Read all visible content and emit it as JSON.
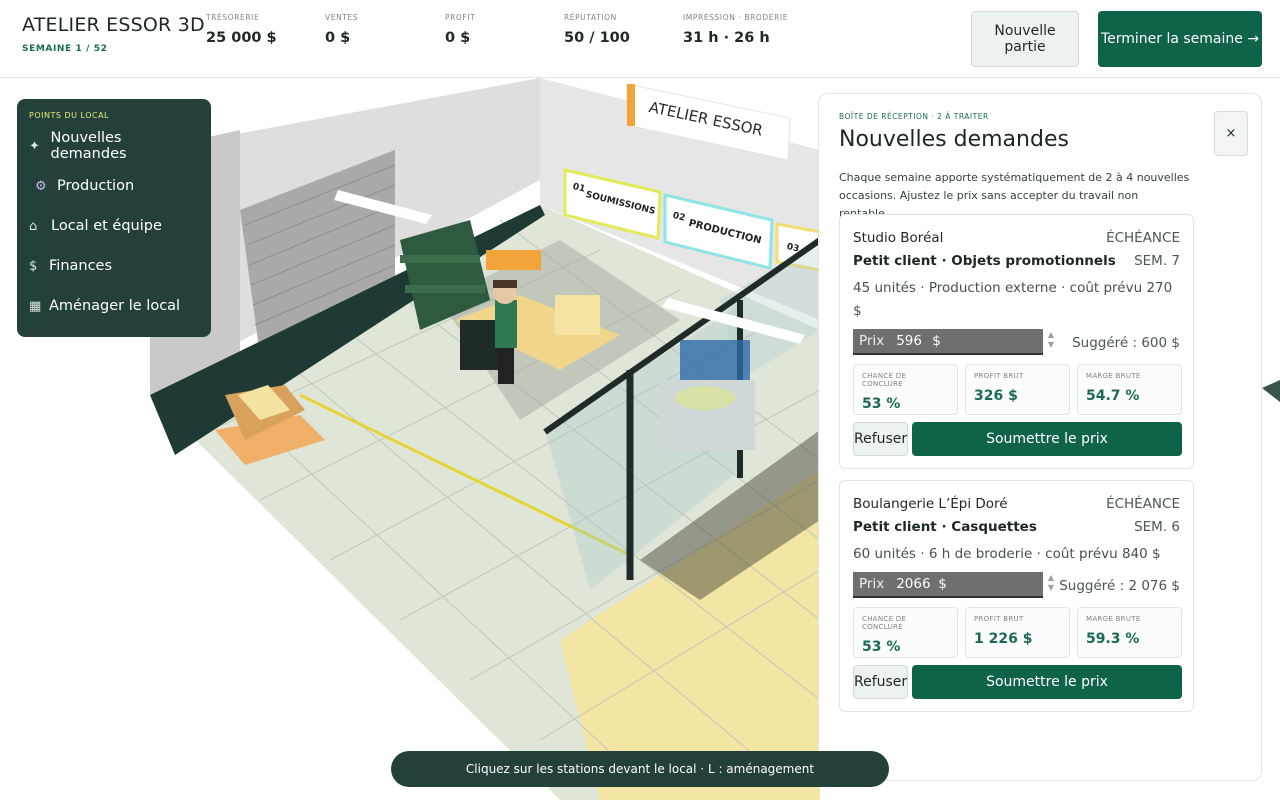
{
  "app": {
    "title": "ATELIER ESSOR 3D",
    "week": "SEMAINE 1 / 52"
  },
  "stats": [
    {
      "label": "TRÉSORERIE",
      "value": "25 000 $"
    },
    {
      "label": "VENTES",
      "value": "0 $"
    },
    {
      "label": "PROFIT",
      "value": "0 $"
    },
    {
      "label": "RÉPUTATION",
      "value": "50 / 100"
    },
    {
      "label": "IMPRESSION · BRODERIE",
      "value": "31 h · 26 h"
    }
  ],
  "actions": {
    "new_game": "Nouvelle partie",
    "end_week": "Terminer la semaine →"
  },
  "nav": {
    "heading": "POINTS DU LOCAL",
    "items": [
      {
        "icon": "sparkle-icon",
        "glyph": "✦",
        "label": "Nouvelles demandes"
      },
      {
        "icon": "gear-icon",
        "glyph": "⚙",
        "label": "Production"
      },
      {
        "icon": "home-icon",
        "glyph": "⌂",
        "label": "Local et équipe"
      },
      {
        "icon": "dollar-icon",
        "glyph": "$",
        "label": "Finances"
      },
      {
        "icon": "grid-icon",
        "glyph": "▦",
        "label": "Aménager le local"
      }
    ]
  },
  "scene": {
    "sign": "ATELIER ESSOR",
    "stations": [
      {
        "num": "01",
        "label": "SOUMISSIONS"
      },
      {
        "num": "02",
        "label": "PRODUCTION"
      },
      {
        "num": "03",
        "label": ""
      }
    ]
  },
  "inbox": {
    "kicker": "BOÎTE DE RÉCEPTION · 2 À TRAITER",
    "title": "Nouvelles demandes",
    "close": "×",
    "description": "Chaque semaine apporte systématiquement de 2 à 4 nouvelles occasions. Ajustez le prix sans accepter du travail non rentable.",
    "due_label": "ÉCHÉANCE",
    "price_label": "Prix",
    "currency": "$",
    "refuse": "Refuser",
    "submit": "Soumettre le prix",
    "metric_labels": [
      "CHANCE DE CONCLURE",
      "PROFIT BRUT",
      "MARGE BRUTE"
    ],
    "requests": [
      {
        "client": "Studio Boréal",
        "type": "Petit client · Objets promotionnels",
        "due": "SEM. 7",
        "details": "45 unités · Production externe · coût prévu 270 $",
        "price": "596",
        "suggested": "Suggéré : 600 $",
        "chance": "53 %",
        "profit": "326 $",
        "margin": "54.7 %"
      },
      {
        "client": "Boulangerie L’Épi Doré",
        "type": "Petit client · Casquettes",
        "due": "SEM. 6",
        "details": "60 unités · 6 h de broderie · coût prévu 840 $",
        "price": "2066",
        "suggested": "Suggéré : 2 076 $",
        "chance": "53 %",
        "profit": "1 226 $",
        "margin": "59.3 %"
      }
    ]
  },
  "hint": "Cliquez sur les stations devant le local · L : aménagement"
}
